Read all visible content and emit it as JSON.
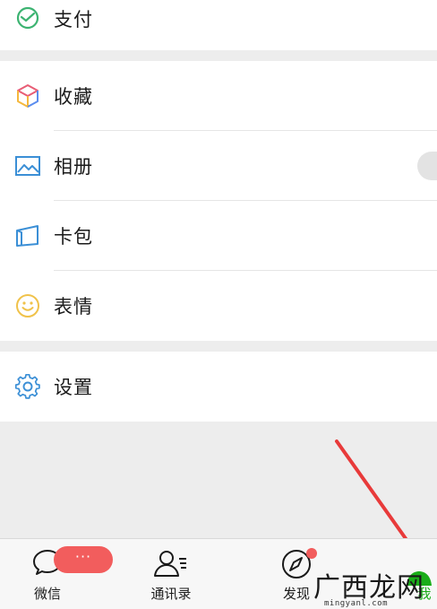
{
  "menu": {
    "payment": {
      "label": "支付",
      "icon": "wechat-pay-icon"
    },
    "favorites": {
      "label": "收藏",
      "icon": "cube-icon"
    },
    "album": {
      "label": "相册",
      "icon": "photo-icon"
    },
    "card_pack": {
      "label": "卡包",
      "icon": "wallet-icon"
    },
    "stickers": {
      "label": "表情",
      "icon": "smiley-icon"
    },
    "settings": {
      "label": "设置",
      "icon": "gear-icon"
    }
  },
  "tabbar": {
    "chats": {
      "label": "微信",
      "badge": "···"
    },
    "contacts": {
      "label": "通讯录"
    },
    "discover": {
      "label": "发现"
    },
    "me": {
      "label": "我"
    }
  },
  "watermark": {
    "brand": "广西龙网",
    "url": "mingyanl.com"
  },
  "colors": {
    "accent_green": "#1aad19",
    "badge_red": "#f25d5d",
    "arrow_red": "#e83a3a",
    "page_bg": "#ededed"
  }
}
